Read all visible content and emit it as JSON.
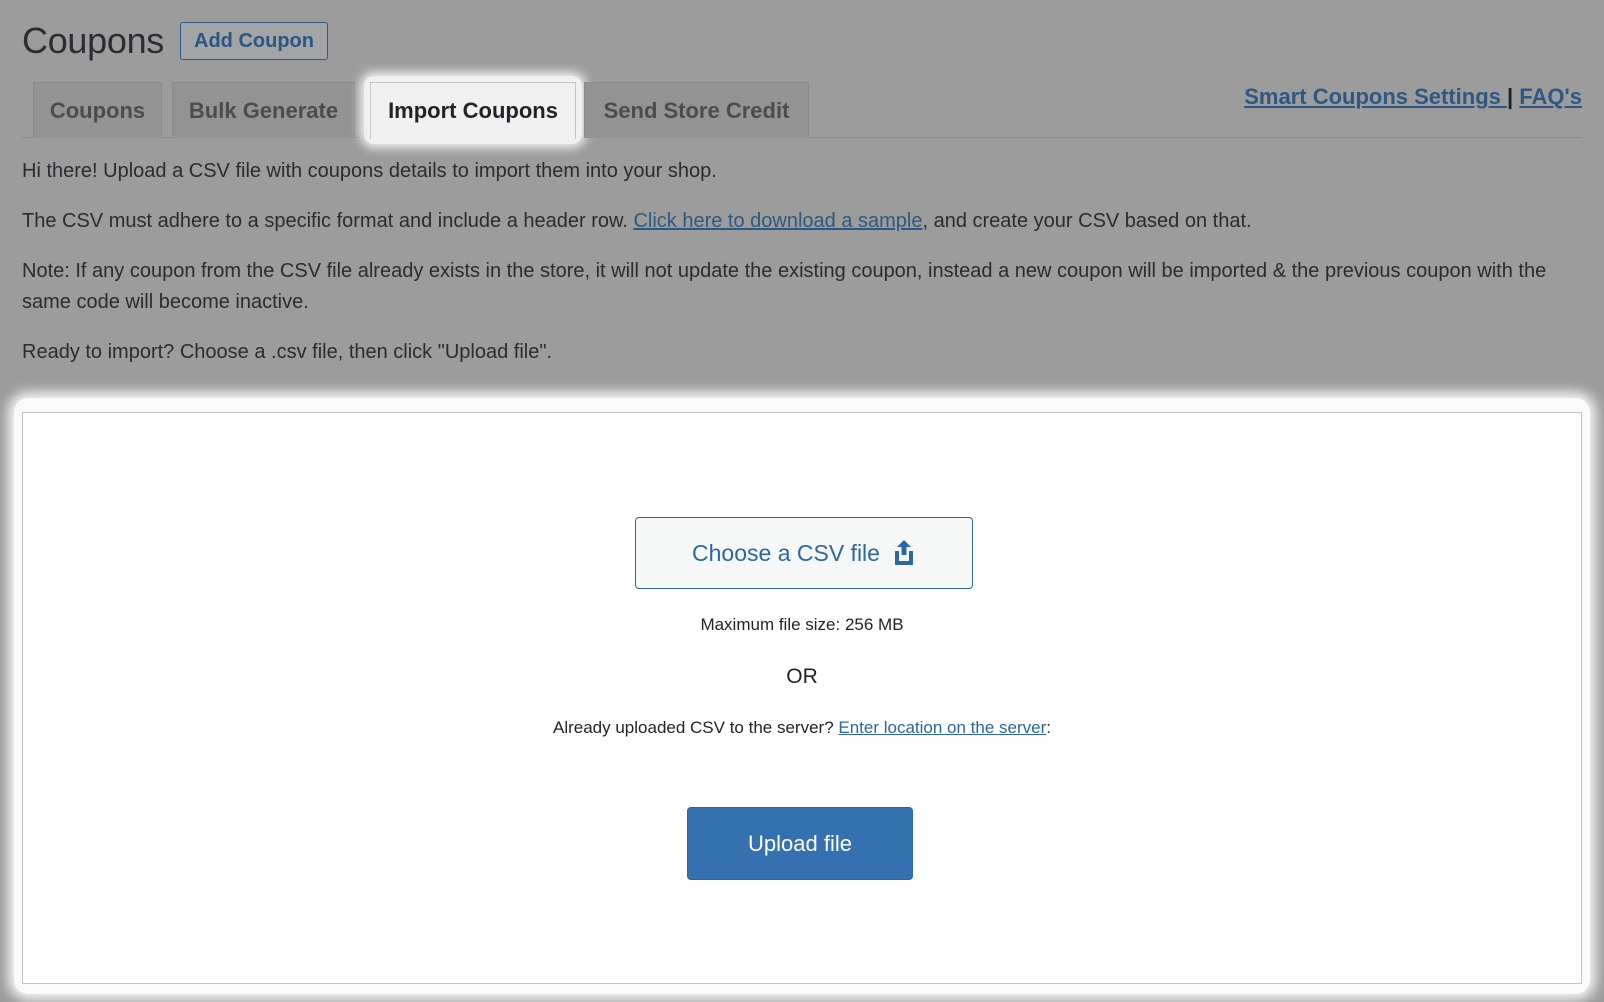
{
  "header": {
    "title": "Coupons",
    "add_button": "Add Coupon"
  },
  "tabs": [
    {
      "label": "Coupons",
      "active": false
    },
    {
      "label": "Bulk Generate",
      "active": false
    },
    {
      "label": "Import Coupons",
      "active": true
    },
    {
      "label": "Send Store Credit",
      "active": false
    }
  ],
  "links": {
    "settings": "Smart Coupons Settings ",
    "separator": "|",
    "faq": "FAQ's"
  },
  "intro": {
    "line1": "Hi there! Upload a CSV file with coupons details to import them into your shop.",
    "line2_before": "The CSV must adhere to a specific format and include a header row. ",
    "line2_link": "Click here to download a sample",
    "line2_after": ", and create your CSV based on that.",
    "note": "Note: If any coupon from the CSV file already exists in the store, it will not update the existing coupon, instead a new coupon will be imported & the previous coupon with the same code will become inactive.",
    "ready": "Ready to import? Choose a .csv file, then click \"Upload file\"."
  },
  "import_card": {
    "choose_label": "Choose a CSV file",
    "choose_icon": "upload-share-icon",
    "max_size": "Maximum file size: 256 MB",
    "or": "OR",
    "server_text": "Already uploaded CSV to the server? ",
    "server_link": "Enter location on the server",
    "server_suffix": ":",
    "upload_label": "Upload file"
  },
  "colors": {
    "accent": "#3571b1",
    "link": "#2c67a3",
    "overlay": "#9c9c9c"
  }
}
